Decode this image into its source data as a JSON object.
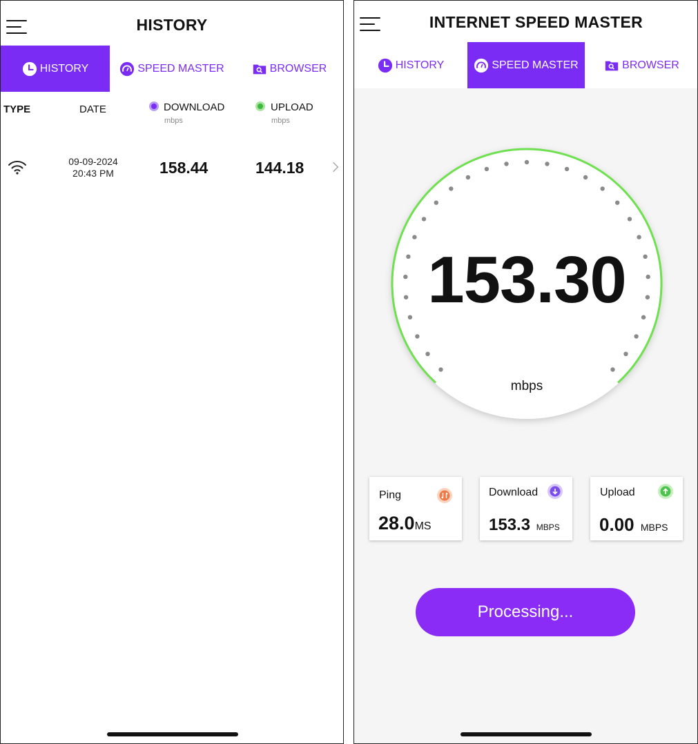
{
  "history_screen": {
    "title": "HISTORY",
    "tabs": [
      {
        "label": "HISTORY",
        "icon": "clock-icon",
        "active": true
      },
      {
        "label": "SPEED MASTER",
        "icon": "speedometer-icon",
        "active": false
      },
      {
        "label": "BROWSER",
        "icon": "folder-search-icon",
        "active": false
      }
    ],
    "columns": {
      "type": "TYPE",
      "date": "DATE",
      "download": "DOWNLOAD",
      "download_unit": "mbps",
      "upload": "UPLOAD",
      "upload_unit": "mbps"
    },
    "rows": [
      {
        "type_icon": "wifi-icon",
        "date": "09-09-2024",
        "time": "20:43 PM",
        "download": "158.44",
        "upload": "144.18"
      }
    ]
  },
  "speed_screen": {
    "title": "INTERNET SPEED MASTER",
    "tabs": [
      {
        "label": "HISTORY",
        "icon": "clock-icon",
        "active": false
      },
      {
        "label": "SPEED MASTER",
        "icon": "speedometer-icon",
        "active": true
      },
      {
        "label": "BROWSER",
        "icon": "folder-search-icon",
        "active": false
      }
    ],
    "gauge": {
      "value": "153.30",
      "unit": "mbps"
    },
    "stats": {
      "ping": {
        "label": "Ping",
        "value": "28.0",
        "unit": "MS"
      },
      "download": {
        "label": "Download",
        "value": "153.3",
        "unit": "MBPS"
      },
      "upload": {
        "label": "Upload",
        "value": "0.00",
        "unit": "MBPS"
      }
    },
    "button_label": "Processing..."
  },
  "colors": {
    "accent": "#7a2cf5",
    "button": "#8a2cf5",
    "gauge_ring": "#6fe04f",
    "ping_icon": "#ef7a45",
    "download_icon": "#7b4cf0",
    "upload_icon": "#4ec24e"
  }
}
